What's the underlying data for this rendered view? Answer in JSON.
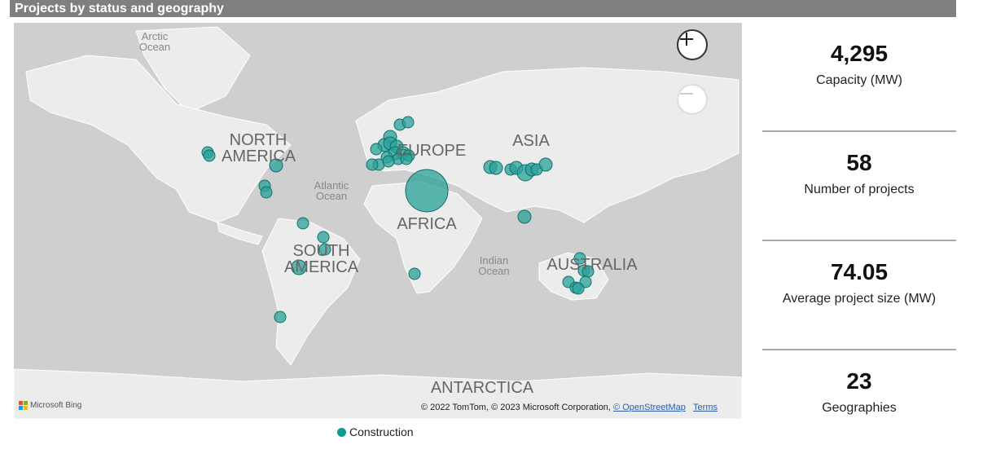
{
  "header": {
    "title": "Projects by status and geography"
  },
  "map": {
    "continent_labels": [
      "NORTH\nAMERICA",
      "EUROPE",
      "ASIA",
      "AFRICA",
      "SOUTH\nAMERICA",
      "AUSTRALIA",
      "ANTARCTICA"
    ],
    "ocean_labels": [
      "Arctic\nOcean",
      "Atlantic\nOcean",
      "Indian\nOcean"
    ],
    "zoom_in_icon": "plus-icon",
    "zoom_out_icon": "minus-icon",
    "provider": "Microsoft Bing",
    "attribution_text": "© 2022 TomTom, © 2023 Microsoft Corporation, ",
    "attribution_link": "© OpenStreetMap",
    "terms_link": "Terms",
    "bubble_color": "#2aa19a",
    "bubble_stroke": "#0f6f6a"
  },
  "legend": {
    "label": "Construction",
    "color": "#0f9a93"
  },
  "kpis": [
    {
      "value": "4,295",
      "label": "Capacity (MW)"
    },
    {
      "value": "58",
      "label": "Number of projects"
    },
    {
      "value": "74.05",
      "label": "Average project size (MW)"
    },
    {
      "value": "23",
      "label": "Geographies"
    }
  ]
}
